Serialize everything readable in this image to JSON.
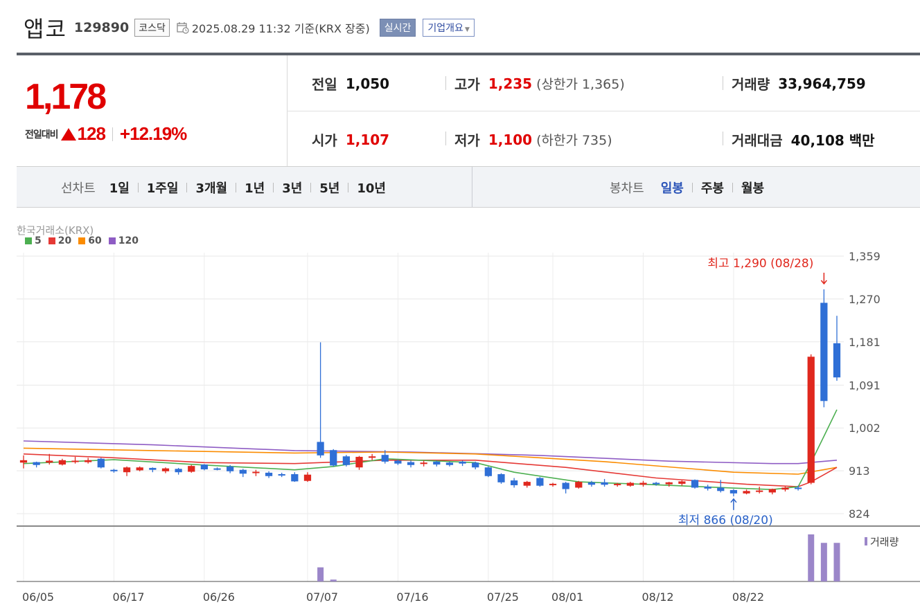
{
  "header": {
    "name": "앱코",
    "code": "129890",
    "market": "코스닥",
    "datetime": "2025.08.29 11:32 기준(KRX 장중)",
    "realtime_btn": "실시간",
    "company_btn": "기업개요"
  },
  "price": {
    "current": "1,178",
    "change_label": "전일대비",
    "change_amount": "128",
    "change_pct": "+12.19%"
  },
  "info": {
    "prev_label": "전일",
    "prev": "1,050",
    "high_label": "고가",
    "high": "1,235",
    "upper_limit": "(상한가 1,365)",
    "volume_label": "거래량",
    "volume": "33,964,759",
    "open_label": "시가",
    "open": "1,107",
    "low_label": "저가",
    "low": "1,100",
    "lower_limit": "(하한가 735)",
    "amount_label": "거래대금",
    "amount": "40,108 백만"
  },
  "periods": {
    "line_label": "선차트",
    "line_items": [
      "1일",
      "1주일",
      "3개월",
      "1년",
      "3년",
      "5년",
      "10년"
    ],
    "candle_label": "봉차트",
    "candle_items": [
      "일봉",
      "주봉",
      "월봉"
    ],
    "candle_active": 0
  },
  "colors": {
    "up": "#e0281e",
    "down": "#2f6fd6",
    "ma5": "#4caf50",
    "ma20": "#e53935",
    "ma60": "#fb8c00",
    "ma120": "#8e5cc4",
    "volume": "#9b86c9"
  },
  "chart_data": {
    "type": "candlestick",
    "source": "한국거래소(KRX)",
    "legend": [
      "5",
      "20",
      "60",
      "120"
    ],
    "y_ticks": [
      1359,
      1270,
      1181,
      1091,
      1002,
      913,
      824
    ],
    "ylim": [
      824,
      1359
    ],
    "x_tick_labels": [
      "06/05",
      "06/17",
      "06/26",
      "07/07",
      "07/16",
      "07/25",
      "08/01",
      "08/12",
      "08/22"
    ],
    "x_tick_index": [
      0,
      7,
      14,
      21,
      28,
      35,
      40,
      47,
      54
    ],
    "x_count": 60,
    "candles": [
      [
        0,
        930,
        935,
        918,
        945
      ],
      [
        1,
        931,
        925,
        920,
        932
      ],
      [
        2,
        930,
        934,
        926,
        948
      ],
      [
        3,
        926,
        935,
        924,
        938
      ],
      [
        4,
        932,
        934,
        928,
        942
      ],
      [
        5,
        931,
        935,
        928,
        940
      ],
      [
        6,
        938,
        920,
        918,
        940
      ],
      [
        7,
        915,
        912,
        909,
        917
      ],
      [
        8,
        910,
        920,
        902,
        922
      ],
      [
        9,
        914,
        920,
        912,
        922
      ],
      [
        10,
        919,
        915,
        910,
        920
      ],
      [
        11,
        912,
        918,
        908,
        920
      ],
      [
        12,
        917,
        910,
        905,
        919
      ],
      [
        13,
        911,
        923,
        909,
        925
      ],
      [
        14,
        926,
        916,
        914,
        927
      ],
      [
        15,
        918,
        917,
        914,
        920
      ],
      [
        16,
        922,
        912,
        908,
        925
      ],
      [
        17,
        915,
        907,
        900,
        917
      ],
      [
        18,
        910,
        911,
        902,
        915
      ],
      [
        19,
        909,
        902,
        898,
        912
      ],
      [
        20,
        906,
        904,
        900,
        909
      ],
      [
        21,
        906,
        891,
        890,
        910
      ],
      [
        22,
        892,
        905,
        890,
        910
      ],
      [
        23,
        973,
        945,
        940,
        1180
      ],
      [
        24,
        956,
        924,
        922,
        958
      ],
      [
        25,
        943,
        925,
        922,
        946
      ],
      [
        26,
        920,
        942,
        915,
        944
      ],
      [
        27,
        940,
        943,
        935,
        948
      ],
      [
        28,
        946,
        932,
        928,
        956
      ],
      [
        29,
        934,
        928,
        925,
        936
      ],
      [
        30,
        931,
        925,
        920,
        934
      ],
      [
        31,
        928,
        930,
        922,
        934
      ],
      [
        32,
        932,
        926,
        922,
        934
      ],
      [
        33,
        930,
        925,
        922,
        932
      ],
      [
        34,
        932,
        928,
        923,
        934
      ],
      [
        35,
        930,
        920,
        916,
        932
      ],
      [
        36,
        920,
        902,
        900,
        922
      ],
      [
        37,
        906,
        889,
        886,
        908
      ],
      [
        38,
        893,
        883,
        878,
        898
      ],
      [
        39,
        882,
        890,
        878,
        892
      ],
      [
        40,
        898,
        882,
        880,
        900
      ],
      [
        41,
        884,
        886,
        880,
        888
      ],
      [
        42,
        888,
        875,
        866,
        890
      ],
      [
        43,
        878,
        890,
        876,
        892
      ],
      [
        44,
        889,
        884,
        880,
        892
      ],
      [
        45,
        889,
        884,
        880,
        896
      ],
      [
        46,
        884,
        886,
        880,
        888
      ],
      [
        47,
        882,
        888,
        880,
        890
      ],
      [
        48,
        884,
        888,
        880,
        892
      ],
      [
        49,
        888,
        886,
        882,
        890
      ],
      [
        50,
        885,
        889,
        880,
        890
      ],
      [
        51,
        886,
        891,
        882,
        893
      ],
      [
        52,
        894,
        878,
        876,
        895
      ],
      [
        53,
        880,
        876,
        872,
        884
      ],
      [
        54,
        878,
        871,
        868,
        894
      ],
      [
        55,
        873,
        866,
        860,
        875
      ],
      [
        56,
        866,
        871,
        864,
        874
      ],
      [
        57,
        870,
        872,
        866,
        880
      ],
      [
        58,
        868,
        875,
        864,
        876
      ],
      [
        59,
        874,
        878,
        870,
        880
      ],
      [
        60,
        878,
        876,
        872,
        882
      ],
      [
        61,
        888,
        1150,
        885,
        1155
      ],
      [
        62,
        1262,
        1058,
        1045,
        1290
      ],
      [
        63,
        1178,
        1107,
        1100,
        1235
      ]
    ],
    "ma": {
      "ma5": [
        [
          0,
          928
        ],
        [
          7,
          936
        ],
        [
          14,
          925
        ],
        [
          21,
          915
        ],
        [
          24,
          922
        ],
        [
          28,
          938
        ],
        [
          35,
          930
        ],
        [
          38,
          910
        ],
        [
          43,
          890
        ],
        [
          48,
          885
        ],
        [
          55,
          877
        ],
        [
          58,
          874
        ],
        [
          60,
          880
        ],
        [
          61,
          930
        ],
        [
          62,
          985
        ],
        [
          63,
          1040
        ]
      ],
      "ma20": [
        [
          0,
          948
        ],
        [
          7,
          940
        ],
        [
          14,
          930
        ],
        [
          21,
          928
        ],
        [
          28,
          935
        ],
        [
          35,
          935
        ],
        [
          42,
          920
        ],
        [
          49,
          898
        ],
        [
          56,
          885
        ],
        [
          60,
          880
        ],
        [
          61,
          890
        ],
        [
          62,
          905
        ],
        [
          63,
          920
        ]
      ],
      "ma60": [
        [
          0,
          960
        ],
        [
          10,
          955
        ],
        [
          21,
          950
        ],
        [
          28,
          952
        ],
        [
          35,
          948
        ],
        [
          45,
          932
        ],
        [
          55,
          910
        ],
        [
          60,
          906
        ],
        [
          63,
          920
        ]
      ],
      "ma120": [
        [
          0,
          975
        ],
        [
          10,
          967
        ],
        [
          21,
          955
        ],
        [
          30,
          952
        ],
        [
          40,
          945
        ],
        [
          50,
          933
        ],
        [
          58,
          928
        ],
        [
          60,
          928
        ],
        [
          63,
          935
        ]
      ]
    },
    "volume": [
      [
        23,
        30
      ],
      [
        24,
        4
      ],
      [
        61,
        100
      ],
      [
        62,
        82
      ],
      [
        63,
        82
      ]
    ],
    "annotations": {
      "high": {
        "label": "최고 1,290 (08/28)",
        "index": 62,
        "value": 1290
      },
      "low": {
        "label": "최저 866 (08/20)",
        "index": 55,
        "value": 866
      }
    },
    "volume_label": "거래량"
  }
}
